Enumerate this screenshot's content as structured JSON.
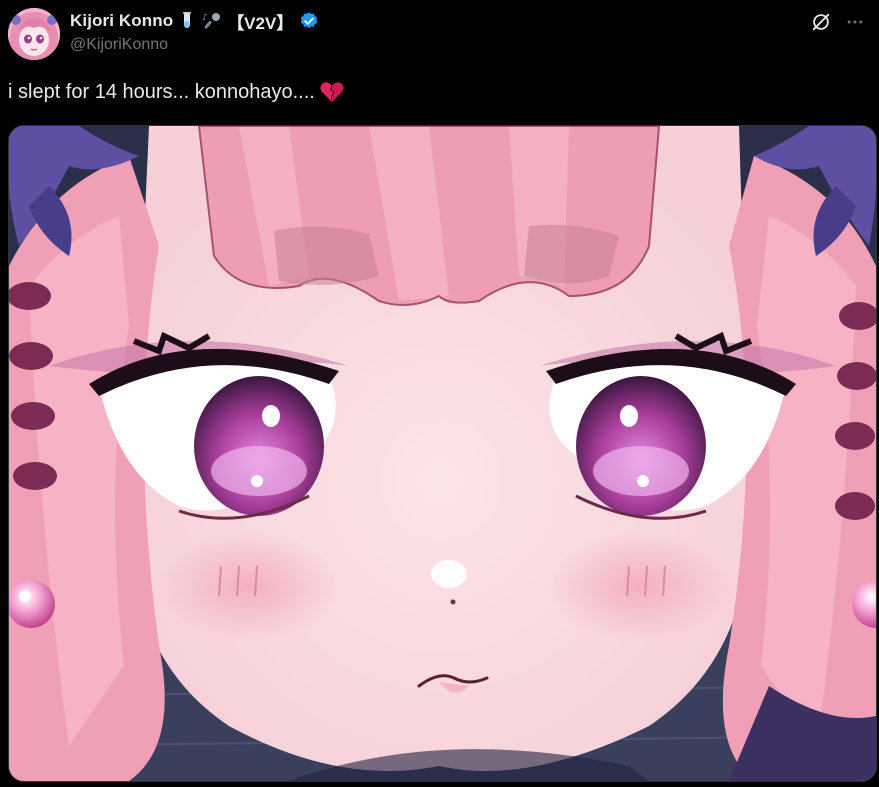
{
  "post": {
    "author": {
      "display_name": "Kijori Konno",
      "tag": "【V2V】",
      "handle": "@KijoriKonno",
      "verified": true,
      "name_emojis": [
        "test-tube-emoji",
        "microphone-notes-emoji"
      ]
    },
    "text": "i slept for 14 hours... konnohayo....",
    "text_emoji": "broken-heart-emoji",
    "media": {
      "type": "image",
      "description_icon": "anime-character-closeup"
    },
    "actions": {
      "grok_icon": "grok-icon",
      "more_icon": "more-options-icon"
    }
  },
  "colors": {
    "background": "#000000",
    "text_primary": "#e7e9ea",
    "text_secondary": "#71767b",
    "verified_blue": "#1d9bf0",
    "broken_heart_red": "#e0245e",
    "media_border": "#2f3336"
  }
}
